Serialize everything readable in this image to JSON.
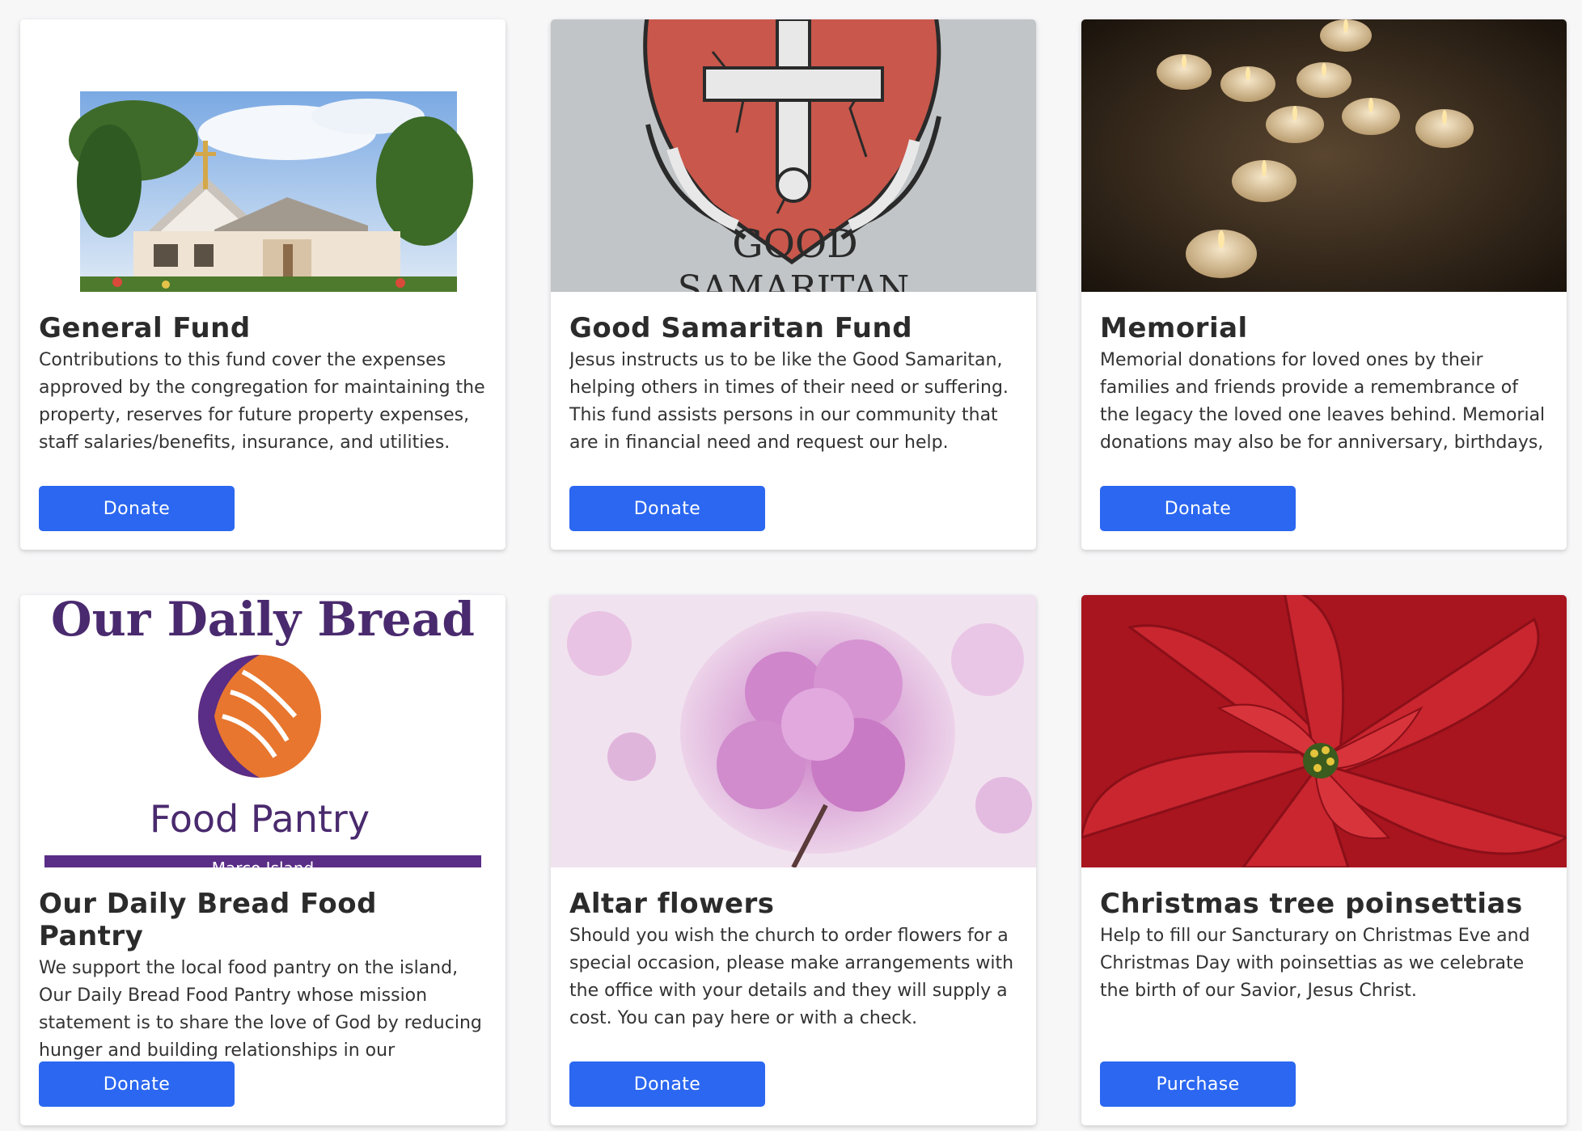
{
  "cards": [
    {
      "title": "General Fund",
      "text": "Contributions to this fund cover the expenses approved by the congregation for maintaining the property, reserves for future property expenses, staff salaries/benefits, insurance, and utilities.",
      "button": "Donate",
      "image": "church-building-photo"
    },
    {
      "title": "Good Samaritan Fund",
      "text": "Jesus instructs us to be like the Good Samaritan, helping others in times of their need or suffering. This fund assists persons in our community that are in financial need and request our help.",
      "button": "Donate",
      "image": "good-samaritan-logo",
      "image_text": [
        "GOOD",
        "SAMARITAN"
      ]
    },
    {
      "title": "Memorial",
      "text": "Memorial donations for loved ones by their families and friends provide a remembrance of the legacy the loved one leaves behind. Memorial donations may also be for anniversary, birthdays, etc.",
      "button": "Donate",
      "image": "candles-photo"
    },
    {
      "title": "Our Daily Bread Food Pantry",
      "text": "We support the local food pantry on the island, Our Daily Bread Food Pantry whose mission statement is to share the love of God by reducing hunger and building relationships in our community.",
      "button": "Donate",
      "image": "food-pantry-logo",
      "image_text": [
        "Our Daily Bread",
        "Food Pantry",
        "Marco Island"
      ]
    },
    {
      "title": "Altar flowers",
      "text": "Should you wish the church to order flowers for a special occasion, please make arrangements with the office with your details and they will supply a cost. You can pay here or with a check.",
      "button": "Donate",
      "image": "pink-flowers-photo"
    },
    {
      "title": "Christmas tree poinsettias",
      "text": "Help to fill our Sancturary on Christmas Eve and Christmas Day with poinsettias as we celebrate the birth of our Savior, Jesus Christ.",
      "button": "Purchase",
      "image": "poinsettia-photo"
    }
  ],
  "colors": {
    "button": "#2b67f0",
    "page_bg": "#f7f7f8",
    "card_bg": "#ffffff"
  }
}
